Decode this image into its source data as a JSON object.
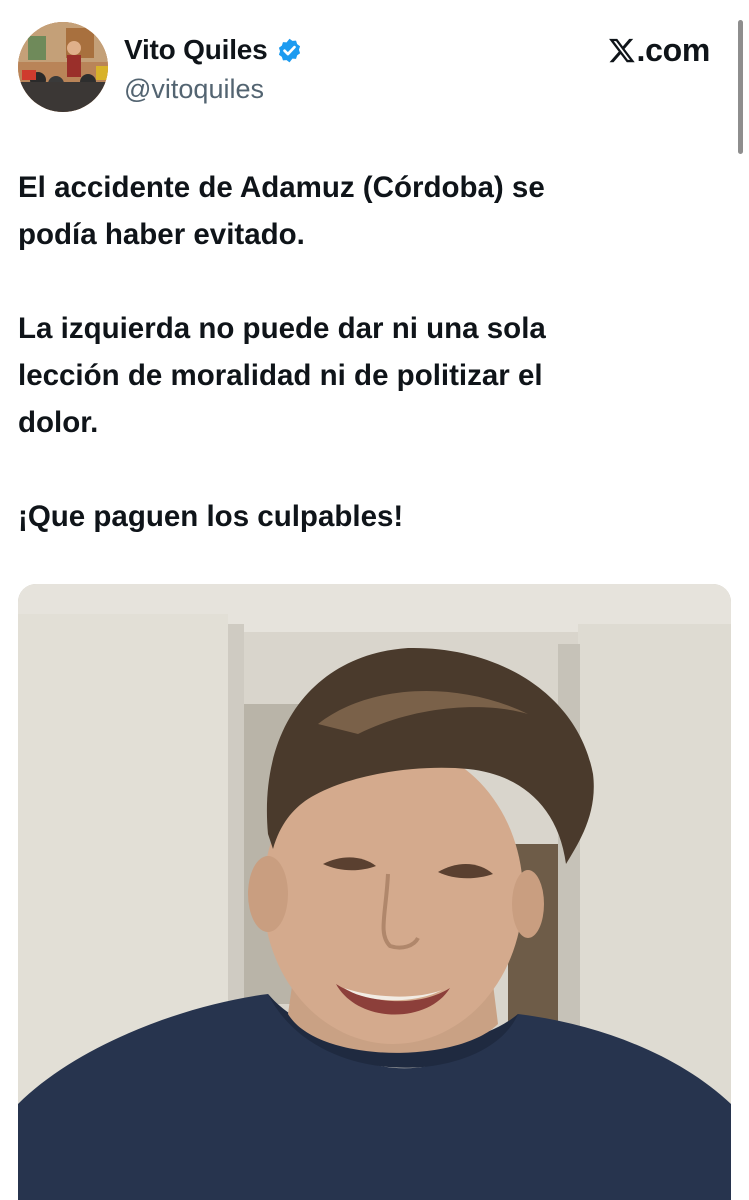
{
  "author": {
    "display_name": "Vito Quiles",
    "handle": "@vitoquiles",
    "verified_icon": "verified-badge-icon",
    "avatar_icon": "profile-photo"
  },
  "brand": {
    "logo_icon": "x-logo-icon",
    "text": ".com"
  },
  "tweet": {
    "lines": [
      "El accidente de Adamuz (Córdoba) se",
      "podía haber evitado.",
      "La izquierda no puede dar ni una sola",
      "lección de moralidad ni de politizar el",
      "dolor.",
      "¡Que paguen los culpables!"
    ]
  },
  "media": {
    "type": "video-thumbnail",
    "description_icon": "embedded-video-frame"
  },
  "colors": {
    "text": "#0f1419",
    "secondary": "#536471",
    "verified": "#1d9bf0"
  }
}
